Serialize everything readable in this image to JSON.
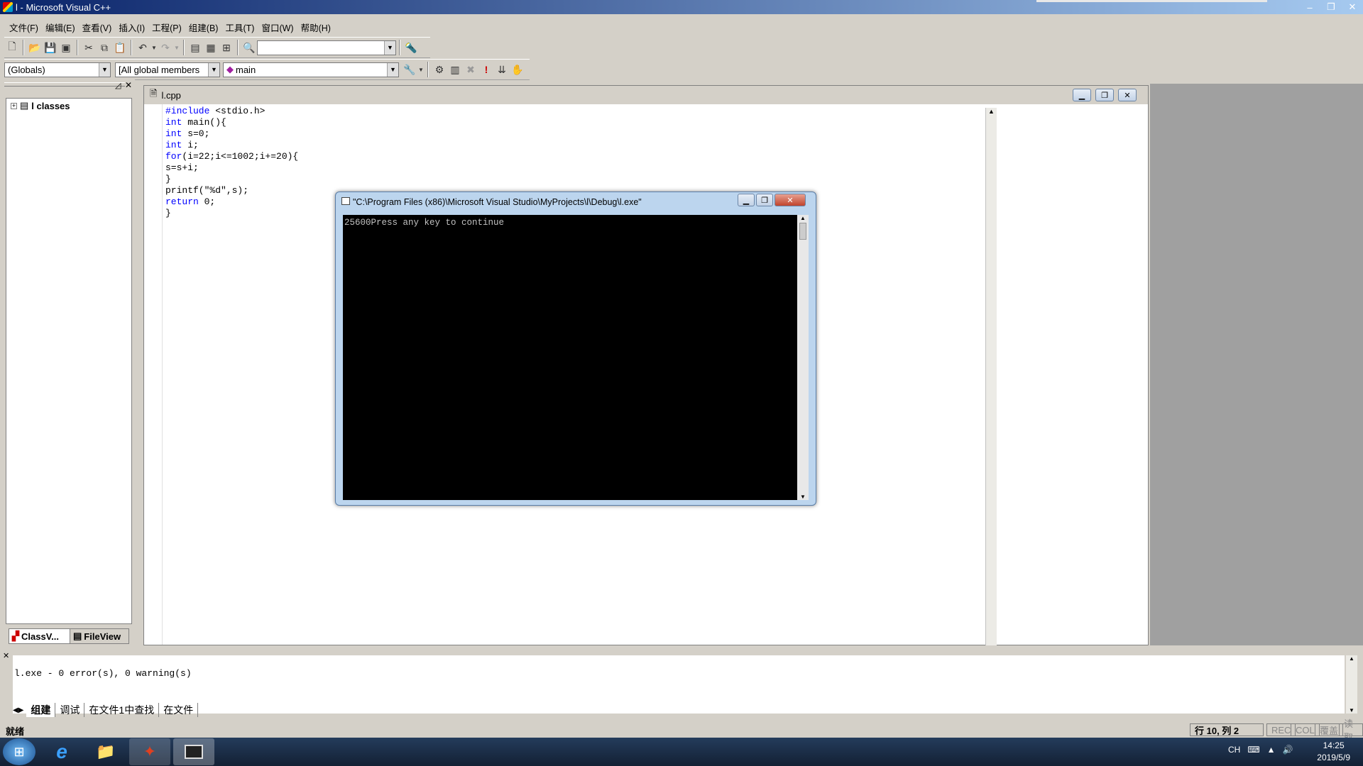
{
  "window": {
    "title": "l - Microsoft Visual C++",
    "min": "–",
    "max": "❐",
    "close": "✕"
  },
  "menu": [
    "文件(F)",
    "编辑(E)",
    "查看(V)",
    "插入(I)",
    "工程(P)",
    "组建(B)",
    "工具(T)",
    "窗口(W)",
    "帮助(H)"
  ],
  "toolbar2": {
    "scope": "(Globals)",
    "members": "[All global members",
    "function": "main"
  },
  "classview": {
    "root": "l classes",
    "tab_class": "ClassV...",
    "tab_file": "FileView"
  },
  "editor": {
    "filename": "l.cpp",
    "lines": [
      {
        "kw": "#include",
        "rest": " <stdio.h>"
      },
      {
        "kw": "int",
        "rest": " main(){"
      },
      {
        "kw": "int",
        "rest": " s=0;"
      },
      {
        "kw": "int",
        "rest": " i;"
      },
      {
        "kw": "for",
        "rest": "(i=22;i<=1002;i+=20){"
      },
      {
        "kw": "",
        "rest": "s=s+i;"
      },
      {
        "kw": "",
        "rest": "}"
      },
      {
        "kw": "",
        "rest": "printf(\"%d\",s);"
      },
      {
        "kw": "return",
        "rest": " 0;"
      },
      {
        "kw": "",
        "rest": "}"
      }
    ]
  },
  "console": {
    "title": "\"C:\\Program Files (x86)\\Microsoft Visual Studio\\MyProjects\\l\\Debug\\l.exe\"",
    "output": "25600Press any key to continue"
  },
  "output_pane": {
    "text": "l.exe - 0 error(s), 0 warning(s)",
    "tabs": [
      "组建",
      "调试",
      "在文件1中查找",
      "在文件"
    ]
  },
  "status": {
    "ready": "就绪",
    "position": "行 10, 列 2",
    "rec": "REC",
    "col": "COL",
    "ovr": "覆盖",
    "read": "读取"
  },
  "taskbar": {
    "lang": "CH",
    "time": "14:25",
    "date": "2019/5/9"
  }
}
